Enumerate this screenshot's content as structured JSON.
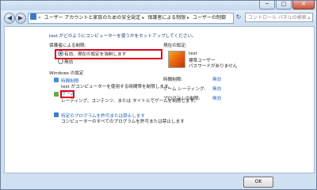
{
  "titlebar": {
    "minimize": "─",
    "maximize": "□",
    "close": "✕"
  },
  "addressbar": {
    "crumbs": [
      "ユーザー アカウントと家族のための安全設定",
      "保護者による制限",
      "ユーザーの制御"
    ],
    "search_placeholder": "コントロール パネルの検索"
  },
  "content": {
    "intro": "test がどのようにコンピューターを使うかをセットアップしてください。",
    "parental_heading": "保護者による制限:",
    "option_on": "有効、現在の設定を強制します",
    "option_off": "無効",
    "windows_settings_heading": "Windows の設定",
    "time_limits_link": "時間制限",
    "time_limits_desc": "test がコンピューターを使用する時間帯を制限します。",
    "games_link": "ゲーム",
    "games_desc": "レーティング、コンテンツ、または タイトルでゲームを制限します。",
    "allow_programs_link": "特定のプログラムを許可または禁止します",
    "allow_programs_desc": "コンピューターのすべてのプログラムを許可または禁止します",
    "current_settings_heading": "現在の設定:",
    "user_name": "test",
    "user_type": "標準ユーザー",
    "user_password": "パスワードがありません",
    "summary": [
      {
        "label": "時間制限:",
        "value": "無効"
      },
      {
        "label": "ゲーム レーティング:",
        "value": "無効"
      },
      {
        "label": "プログラムの制限:",
        "value": "無効"
      }
    ]
  },
  "footer": {
    "ok_label": "OK"
  },
  "colors": {
    "highlight_box": "#e0001b",
    "link": "#1f62c0"
  }
}
